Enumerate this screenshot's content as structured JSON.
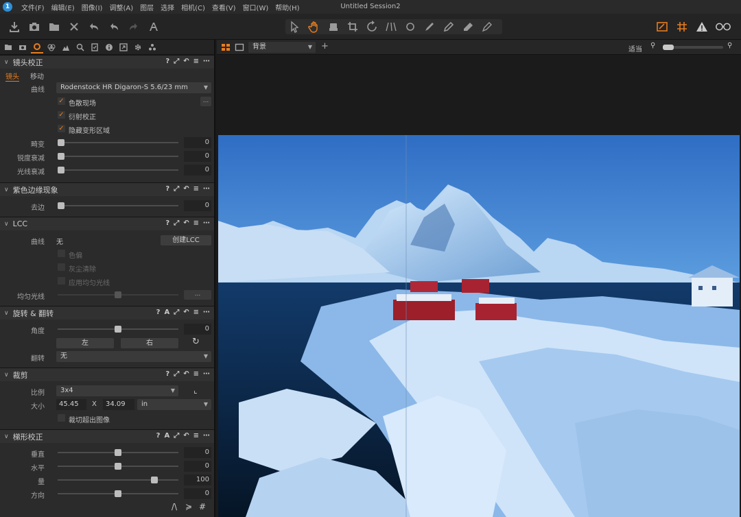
{
  "window": {
    "title": "Untitled Session2",
    "menu": [
      "文件(F)",
      "编辑(E)",
      "图像(I)",
      "调整(A)",
      "图层",
      "选择",
      "相机(C)",
      "查看(V)",
      "窗口(W)",
      "帮助(H)"
    ]
  },
  "toolbar": {
    "left_icons": [
      "import-icon",
      "camera-icon",
      "folder-icon",
      "delete-icon",
      "undo-all-icon",
      "undo-icon",
      "redo-icon",
      "text-annotation-icon"
    ],
    "center_icons": [
      "pointer-icon",
      "pan-icon",
      "fill-icon",
      "crop-icon",
      "rotate-icon",
      "keystone-icon",
      "spot-icon",
      "brush-icon",
      "pen-icon",
      "eraser-icon",
      "gradient-icon"
    ],
    "right_icons": [
      "overlay-icon",
      "grid-icon",
      "warning-icon",
      "glasses-icon"
    ],
    "accent": "#e87d1e"
  },
  "viewer": {
    "background_label": "背景",
    "zoom_label": "适当"
  },
  "lens": {
    "title": "镜头校正",
    "tab_lens": "镜头",
    "tab_move": "移动",
    "profile_label": "曲线",
    "profile_value": "Rodenstock HR Digaron-S 5.6/23 mm",
    "check_ca": "色散现场",
    "check_diffraction": "衍射校正",
    "check_hide_distorted": "隐藏变形区域",
    "distortion_label": "畸变",
    "distortion_value": "0",
    "sharpness_label": "锐度衰减",
    "sharpness_value": "0",
    "light_label": "光线衰减",
    "light_value": "0"
  },
  "purple": {
    "title": "紫色边缘现象",
    "remove_label": "去边",
    "remove_value": "0"
  },
  "lcc": {
    "title": "LCC",
    "profile_label": "曲线",
    "profile_value": "无",
    "create_button": "创建LCC",
    "check_color": "色偏",
    "check_dust": "灰尘清除",
    "check_uniform": "应用均匀光线",
    "uniform_label": "均匀光线"
  },
  "rotate": {
    "title": "旋转 & 翻转",
    "angle_label": "角度",
    "angle_value": "0",
    "left_button": "左",
    "right_button": "右",
    "flip_label": "翻转",
    "flip_value": "无"
  },
  "crop": {
    "title": "裁剪",
    "ratio_label": "比例",
    "ratio_value": "3x4",
    "size_label": "大小",
    "width_value": "45.45",
    "times": "X",
    "height_value": "34.09",
    "unit_value": "in",
    "crop_outside_label": "裁切超出图像"
  },
  "keystone": {
    "title": "梯形校正",
    "vertical_label": "垂直",
    "vertical_value": "0",
    "horizontal_label": "水平",
    "horizontal_value": "0",
    "amount_label": "量",
    "amount_value": "100",
    "aspect_label": "方向",
    "aspect_value": "0"
  }
}
